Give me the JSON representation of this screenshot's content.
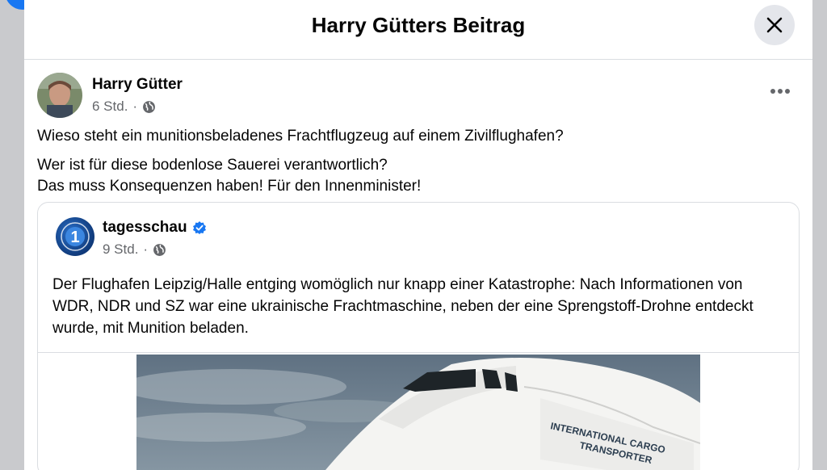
{
  "modal": {
    "title": "Harry Gütters Beitrag"
  },
  "post": {
    "author": "Harry Gütter",
    "time": "6 Std.",
    "separator": "·",
    "paragraphs": [
      "Wieso steht ein munitionsbeladenes Frachtflugzeug auf einem Zivilflughafen?",
      "Wer ist für diese bodenlose Sauerei verantwortlich?",
      "Das muss Konsequenzen haben! Für den Innenminister!"
    ]
  },
  "shared": {
    "page_name": "tagesschau",
    "time": "9 Std.",
    "separator": "·",
    "text": "Der Flughafen Leipzig/Halle entging womöglich nur knapp einer Katastrophe: Nach Informationen von WDR, NDR und SZ war eine ukrainische Frachtmaschine, neben der eine Sprengstoff-Drohne entdeckt wurde, mit Munition beladen.",
    "image_lettering": [
      "INTERNATIONAL CARGO",
      "TRANSPORTER"
    ]
  },
  "icons": {
    "close": "close-icon",
    "globe": "globe-icon",
    "more": "more-options-icon",
    "verified": "verified-badge-icon",
    "logo": "tagesschau-logo"
  },
  "colors": {
    "brand_blue": "#1877f2",
    "secondary_text": "#65676b",
    "close_bg": "#e4e6eb"
  }
}
